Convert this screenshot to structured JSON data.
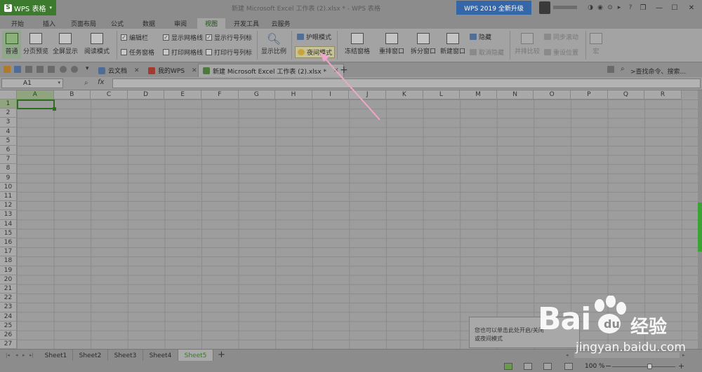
{
  "titlebar": {
    "app_label": "WPS 表格",
    "window_title": "新建 Microsoft Excel 工作表 (2).xlsx * - WPS 表格",
    "upgrade_label": "WPS 2019 全新升级"
  },
  "menu": {
    "tabs": [
      "开始",
      "插入",
      "页面布局",
      "公式",
      "数据",
      "审阅",
      "视图",
      "开发工具",
      "云服务"
    ],
    "active": "视图"
  },
  "ribbon": {
    "normal": "普通",
    "page_preview": "分页预览",
    "fullscreen": "全屏显示",
    "reading_mode": "阅读模式",
    "edit_bar": "编辑栏",
    "task_pane": "任务窗格",
    "show_gridlines": "显示网格线",
    "print_gridlines": "打印网格线",
    "show_headers": "显示行号列标",
    "print_headers": "打印行号列标",
    "zoom": "显示比例",
    "eye_mode": "护眼模式",
    "night_mode": "夜间模式",
    "freeze": "冻结窗格",
    "rearrange": "重排窗口",
    "split": "拆分窗口",
    "new_window": "新建窗口",
    "hide": "隐藏",
    "unhide": "取消隐藏",
    "side_by_side": "并排比较",
    "sync_scroll": "同步滚动",
    "reset_position": "重设位置",
    "macro": "宏"
  },
  "doctabs": {
    "cloud": "云文档",
    "mywps": "我的WPS",
    "active_doc": "新建 Microsoft Excel 工作表 (2).xlsx *",
    "search_cmd": "查找命令、搜索..."
  },
  "formula_bar": {
    "name_box": "A1",
    "fx": "fx"
  },
  "grid": {
    "columns": [
      "A",
      "B",
      "C",
      "D",
      "E",
      "F",
      "G",
      "H",
      "I",
      "J",
      "K",
      "L",
      "M",
      "N",
      "O",
      "P",
      "Q",
      "R"
    ],
    "rows": [
      "1",
      "2",
      "3",
      "4",
      "5",
      "6",
      "7",
      "8",
      "9",
      "10",
      "11",
      "12",
      "13",
      "14",
      "15",
      "16",
      "17",
      "18",
      "19",
      "20",
      "21",
      "22",
      "23",
      "24",
      "25",
      "26",
      "27"
    ],
    "active_cell": "A1"
  },
  "sheets": {
    "tabs": [
      "Sheet1",
      "Sheet2",
      "Sheet3",
      "Sheet4",
      "Sheet5"
    ],
    "active": "Sheet5"
  },
  "status": {
    "zoom": "100 %"
  },
  "tooltip": {
    "text": "您也可以单击此处开启/关闭",
    "text2": "或夜间模式"
  },
  "watermark": {
    "brand": "Bai",
    "brand_suffix": "经验",
    "url": "jingyan.baidu.com"
  },
  "colors": {
    "accent": "#3c7a2d",
    "upgrade": "#3566a8",
    "annotation_arrow": "#f0a6c8"
  }
}
